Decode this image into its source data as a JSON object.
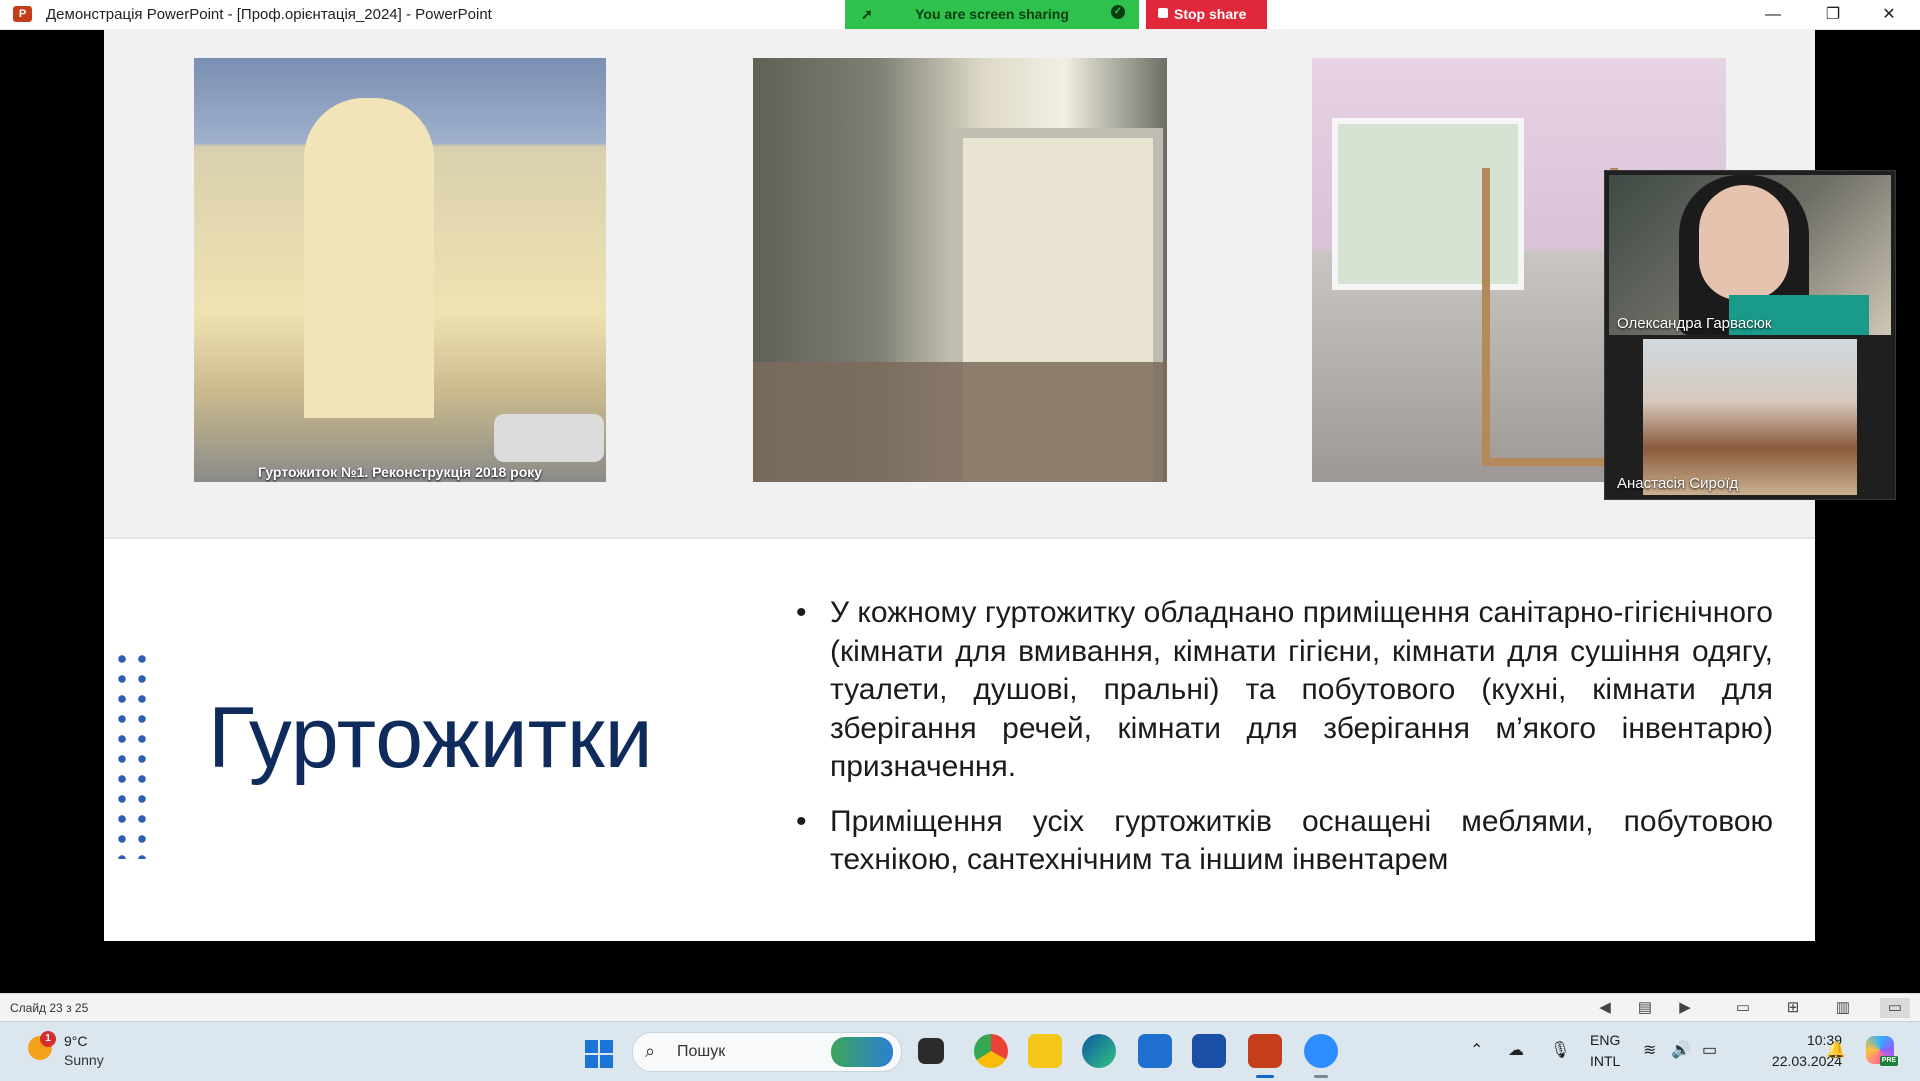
{
  "window": {
    "app_icon": "P",
    "title": "Демонстрація PowerPoint - [Проф.орієнтація_2024] - PowerPoint",
    "controls": {
      "minimize": "—",
      "restore": "❐",
      "close": "✕"
    }
  },
  "share": {
    "status_text": "You are screen sharing",
    "stop_label": "Stop share",
    "colors": {
      "sharing": "#2ec24c",
      "stop": "#e0283a"
    }
  },
  "slide": {
    "title": "Гуртожитки",
    "photo_caption": "Гуртожиток №1. Реконструкція 2018 року",
    "bullet_glyph": "•",
    "bullets": [
      "У кожному гуртожитку обладнано приміщення санітарно-гігієнічного (кімнати для вмивання, кімнати гігієни, кімнати для сушіння одягу, туалети, душові, пральні) та побутового (кухні, кімнати для зберігання речей, кімнати для зберігання м’якого інвентарю) призначення.",
      "Приміщення усіх гуртожитків оснащені меблями, побутовою технікою, сантехнічним та іншим інвентарем"
    ],
    "colors": {
      "title": "#0f2b5b",
      "dots": "#2f5fb3"
    }
  },
  "video": {
    "participants": [
      {
        "name": "Олександра Гарвасюк"
      },
      {
        "name": "Анастасія Сироїд"
      }
    ]
  },
  "statusbar": {
    "slide_counter": "Слайд 23 з 25",
    "icons": [
      "previous-icon",
      "menu-icon",
      "next-icon",
      "normal-view-icon",
      "slide-sorter-icon",
      "reading-view-icon",
      "slideshow-icon"
    ]
  },
  "taskbar": {
    "weather": {
      "temp": "9°C",
      "condition": "Sunny",
      "badge": "1"
    },
    "search_placeholder": "Пошук",
    "apps": [
      "task-view",
      "chrome",
      "file-explorer",
      "edge",
      "microsoft-store",
      "app-m",
      "powerpoint",
      "zoom"
    ],
    "lang_line1": "ENG",
    "lang_line2": "INTL",
    "time": "10:39",
    "date": "22.03.2024",
    "copilot_badge": "PRE"
  }
}
